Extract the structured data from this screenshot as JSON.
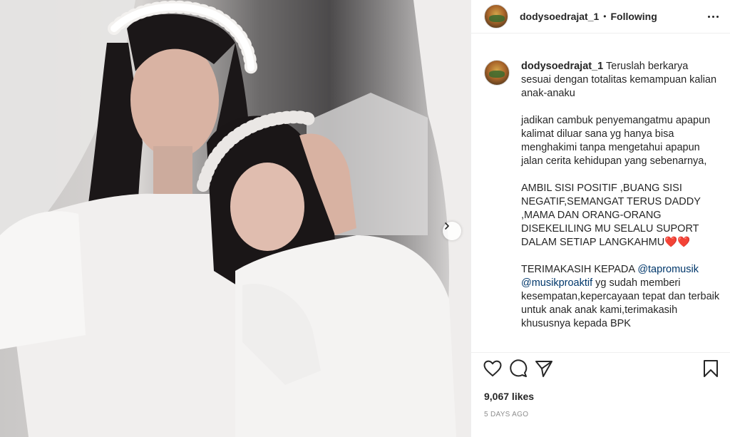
{
  "post": {
    "username": "dodysoedrajat_1",
    "separator": "•",
    "follow_status": "Following",
    "caption": {
      "author": "dodysoedrajat_1",
      "paragraph_1": "Teruslah berkarya sesuai dengan totalitas kemampuan kalian anak-anaku",
      "paragraph_2": "jadikan cambuk penyemangatmu apapun kalimat diluar sana yg hanya bisa menghakimi tanpa mengetahui apapun jalan cerita kehidupan yang sebenarnya,",
      "paragraph_3": "AMBIL SISI POSITIF ,BUANG SISI NEGATIF,SEMANGAT TERUS DADDY ,MAMA DAN ORANG-ORANG DISEKELILING MU SELALU SUPORT DALAM SETIAP LANGKAHMU",
      "paragraph_3_emoji": "❤️❤️",
      "paragraph_4_lead": "TERIMAKASIH KEPADA",
      "mention_1": "@tapromusik",
      "mention_2": "@musikproaktif",
      "paragraph_4_rest": "yg sudah memberi kesempatan,kepercayaan tepat dan terbaik untuk anak anak kami,terimakasih khususnya kepada BPK"
    },
    "likes": "9,067 likes",
    "date": "5 DAYS AGO",
    "icons": {
      "like": "heart-icon",
      "comment": "comment-icon",
      "share": "share-icon",
      "save": "bookmark-icon",
      "more": "more-options-icon",
      "next": "chevron-right-icon"
    },
    "colors": {
      "text": "#262626",
      "secondary_text": "#8e8e8e",
      "mention": "#00376b",
      "border": "#efefef"
    }
  }
}
